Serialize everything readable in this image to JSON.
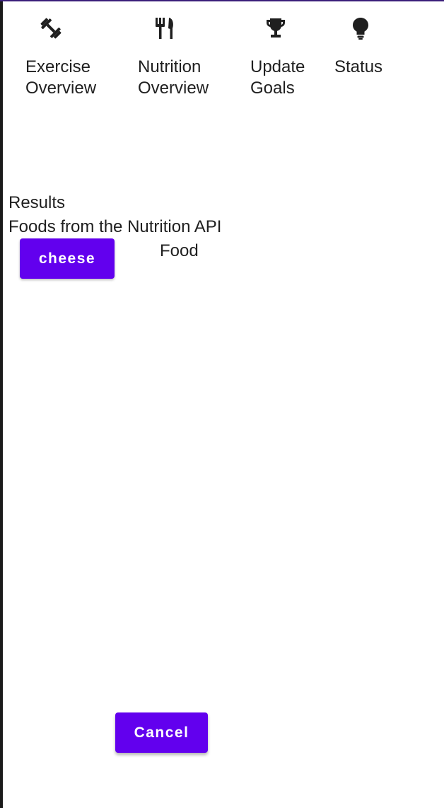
{
  "nav": {
    "items": [
      {
        "id": "exercise",
        "icon": "dumbbell-icon",
        "line1": "Exercise",
        "line2": "Overview"
      },
      {
        "id": "nutrition",
        "icon": "fork-knife-icon",
        "line1": "Nutrition",
        "line2": "Overview"
      },
      {
        "id": "goals",
        "icon": "trophy-icon",
        "line1": "Update",
        "line2": "Goals"
      },
      {
        "id": "status",
        "icon": "lightbulb-icon",
        "line1": "Status",
        "line2": ""
      }
    ]
  },
  "results": {
    "title": "Results",
    "subtitle": "Foods from the Nutrition API",
    "items": [
      {
        "button_label": "cheese",
        "type_label": "Food"
      }
    ]
  },
  "actions": {
    "cancel_label": "Cancel"
  },
  "colors": {
    "accent": "#6200ee",
    "text": "#202020",
    "background": "#ffffff"
  }
}
